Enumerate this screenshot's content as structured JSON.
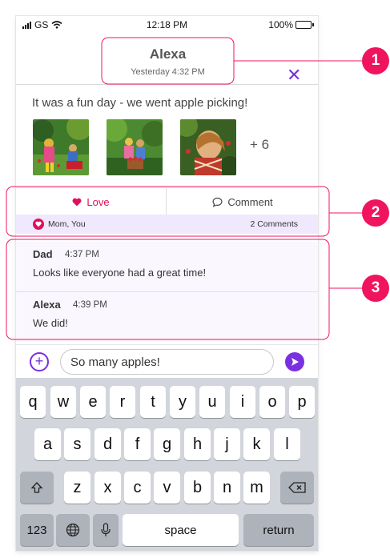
{
  "status_bar": {
    "carrier": "GS",
    "time": "12:18 PM",
    "battery": "100%",
    "battery_level": 1.0
  },
  "header": {
    "title": "Alexa",
    "subtitle": "Yesterday 4:32 PM",
    "close_icon": "close-icon"
  },
  "post": {
    "text": "It was a fun day - we went apple picking!",
    "photos": [
      {
        "name": "apple-picking-photo-1"
      },
      {
        "name": "apple-picking-photo-2"
      },
      {
        "name": "apple-picking-photo-3"
      }
    ],
    "more_count": "+ 6"
  },
  "actions": {
    "love_label": "Love",
    "comment_label": "Comment"
  },
  "reactions": {
    "names": "Mom, You",
    "comment_count": "2 Comments"
  },
  "comments": [
    {
      "author": "Dad",
      "time": "4:37 PM",
      "text": "Looks like everyone had a great time!"
    },
    {
      "author": "Alexa",
      "time": "4:39 PM",
      "text": "We did!"
    }
  ],
  "composer": {
    "value": "So many apples!"
  },
  "keyboard": {
    "row1": [
      "q",
      "w",
      "e",
      "r",
      "t",
      "y",
      "u",
      "i",
      "o",
      "p"
    ],
    "row2": [
      "a",
      "s",
      "d",
      "f",
      "g",
      "h",
      "j",
      "k",
      "l"
    ],
    "row3": [
      "z",
      "x",
      "c",
      "v",
      "b",
      "n",
      "m"
    ],
    "numbers_label": "123",
    "space_label": "space",
    "return_label": "return"
  },
  "colors": {
    "accent_purple": "#7a2fe0",
    "love_pink": "#e0105c",
    "callout": "#f0145f"
  },
  "callouts": [
    "1",
    "2",
    "3"
  ]
}
